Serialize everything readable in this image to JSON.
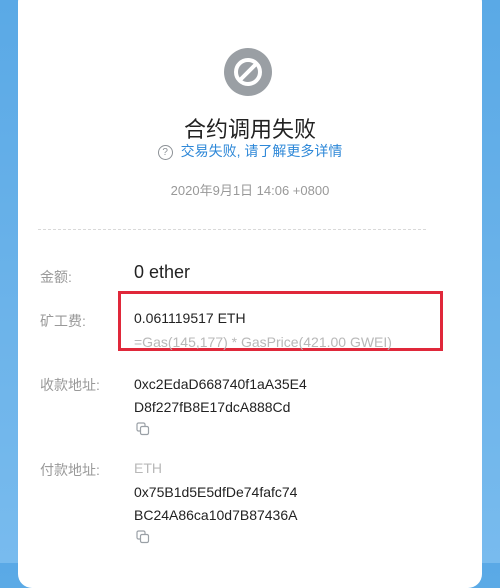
{
  "header": {
    "status_icon": "prohibited-icon",
    "title": "合约调用失败",
    "failure_link": "交易失败, 请了解更多详情",
    "help_icon": "question-circle-icon",
    "timestamp": "2020年9月1日 14:06 +0800"
  },
  "amount": {
    "label": "金额:",
    "value": "0 ether"
  },
  "fee": {
    "label": "矿工费:",
    "value": "0.061119517 ETH",
    "formula": "=Gas(145,177) * GasPrice(421.00 GWEI)"
  },
  "receiver": {
    "label": "收款地址:",
    "address_line1": "0xc2EdaD668740f1aA35E4",
    "address_line2": "D8f227fB8E17dcA888Cd",
    "copy_icon": "copy-icon"
  },
  "sender": {
    "label": "付款地址:",
    "token": "ETH",
    "address_line1": "0x75B1d5E5dfDe74fafc74",
    "address_line2": "BC24A86ca10d7B87436A",
    "copy_icon": "copy-icon"
  },
  "colors": {
    "accent": "#2e88d8",
    "highlight": "#e0283a",
    "background": "#6db4ea"
  }
}
